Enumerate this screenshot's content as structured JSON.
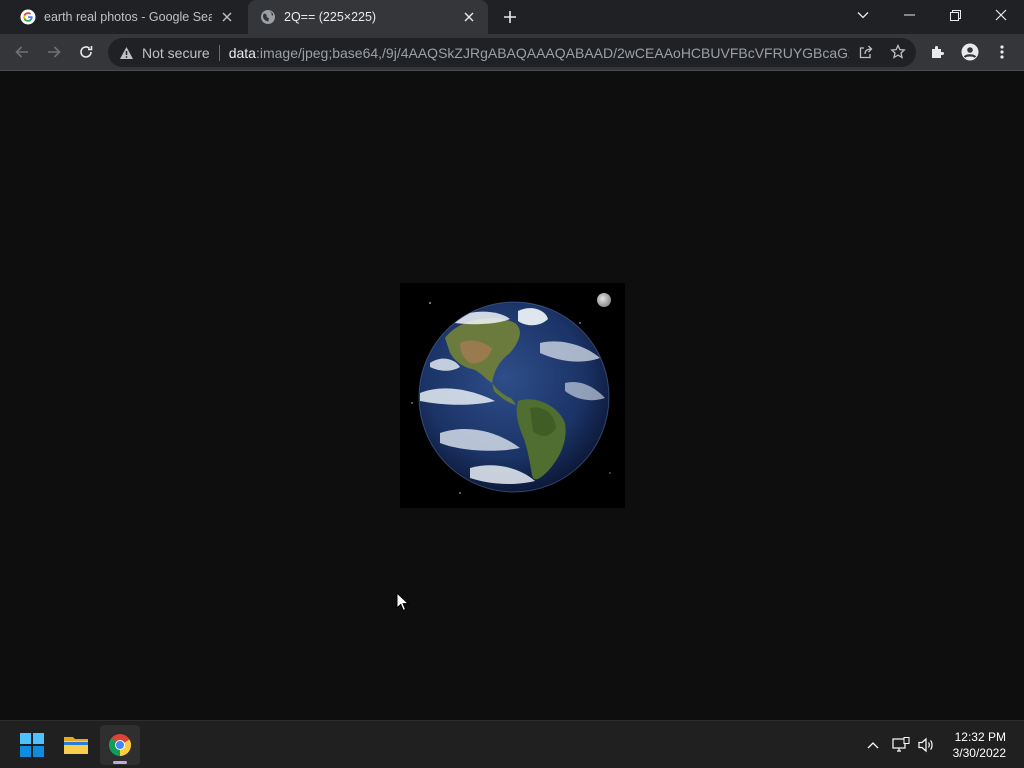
{
  "browser": {
    "tabs": [
      {
        "title": "earth real photos - Google Search",
        "favicon": "google-g-icon",
        "active": false
      },
      {
        "title": "2Q== (225×225)",
        "favicon": "globe-icon",
        "active": true
      }
    ],
    "omnibox": {
      "security_label": "Not secure",
      "url_scheme": "data",
      "url_rest": ":image/jpeg;base64,/9j/4AAQSkZJRgABAQAAAQABAAD/2wCEAAoHCBUVFBcVFRUYGBcaGx0d..."
    }
  },
  "image": {
    "alt": "Earth",
    "width": 225,
    "height": 225
  },
  "taskbar": {
    "apps": [
      "windows-start-icon",
      "file-explorer-icon",
      "chrome-icon"
    ],
    "clock": {
      "time": "12:32 PM",
      "date": "3/30/2022"
    }
  },
  "colors": {
    "tab_strip": "#202124",
    "toolbar": "#35363a",
    "omnibox": "#202124",
    "viewport": "#0e0e0e",
    "taskbar": "#202020"
  }
}
